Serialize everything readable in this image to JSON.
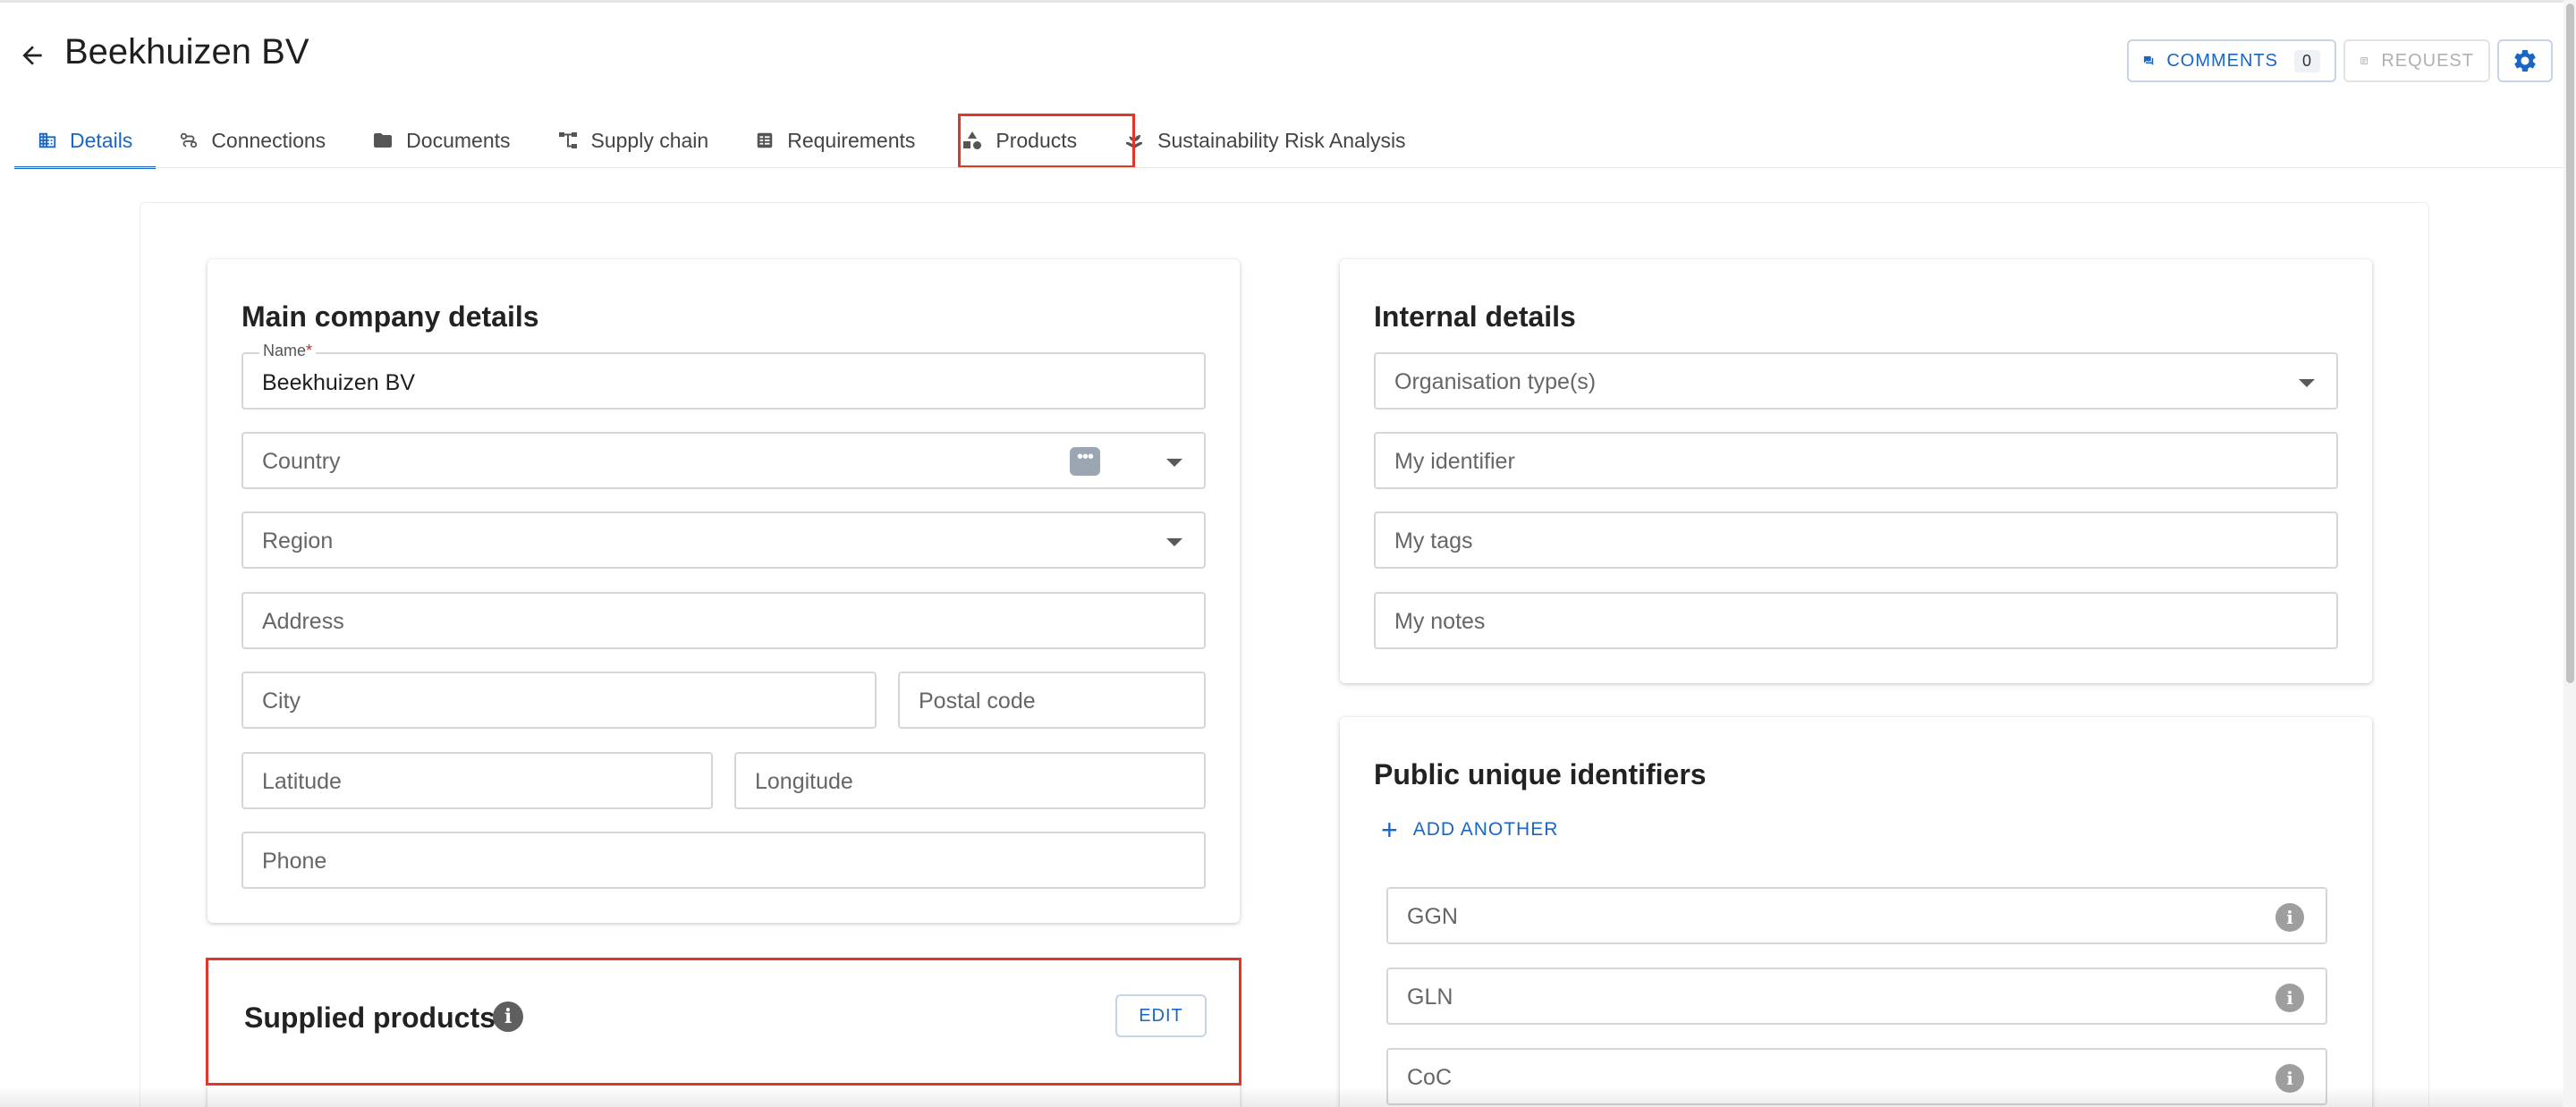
{
  "header": {
    "title": "Beekhuizen BV",
    "comments_label": "COMMENTS",
    "comments_count": "0",
    "request_label": "REQUEST"
  },
  "tabs": [
    {
      "label": "Details",
      "icon": "building-icon",
      "active": true
    },
    {
      "label": "Connections",
      "icon": "connections-icon",
      "active": false
    },
    {
      "label": "Documents",
      "icon": "folder-icon",
      "active": false
    },
    {
      "label": "Supply chain",
      "icon": "supply-chain-icon",
      "active": false
    },
    {
      "label": "Requirements",
      "icon": "checklist-icon",
      "active": false
    },
    {
      "label": "Products",
      "icon": "shapes-icon",
      "active": false
    },
    {
      "label": "Sustainability Risk Analysis",
      "icon": "plant-hand-icon",
      "active": false
    }
  ],
  "main_details": {
    "title": "Main company details",
    "name_label": "Name",
    "name_required": "*",
    "name_value": "Beekhuizen BV",
    "country_placeholder": "Country",
    "region_placeholder": "Region",
    "address_placeholder": "Address",
    "city_placeholder": "City",
    "postal_placeholder": "Postal code",
    "latitude_placeholder": "Latitude",
    "longitude_placeholder": "Longitude",
    "phone_placeholder": "Phone"
  },
  "internal_details": {
    "title": "Internal details",
    "org_type_placeholder": "Organisation type(s)",
    "identifier_placeholder": "My identifier",
    "tags_placeholder": "My tags",
    "notes_placeholder": "My notes"
  },
  "public_ids": {
    "title": "Public unique identifiers",
    "add_label": "ADD ANOTHER",
    "ggn_placeholder": "GGN",
    "gln_placeholder": "GLN",
    "coc_placeholder": "CoC"
  },
  "supplied_products": {
    "title": "Supplied products",
    "edit_label": "EDIT"
  },
  "colors": {
    "accent": "#1a66c4",
    "highlight": "#e3362a"
  }
}
